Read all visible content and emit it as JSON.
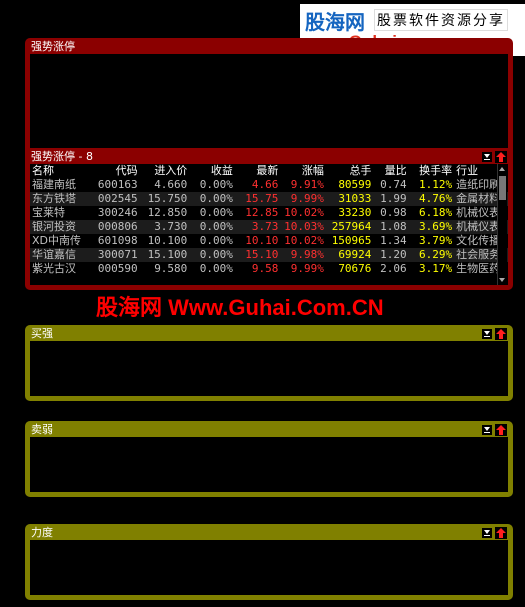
{
  "logo": {
    "brand": "股海网",
    "tagline": "股票软件资源分享",
    "url": "www.Guhai.com.cn"
  },
  "watermark": "股海网 Www.Guhai.Com.CN",
  "panels": {
    "top": {
      "title": "强势涨停"
    },
    "main": {
      "title": "强势涨停 - 8",
      "columns": [
        "名称",
        "代码",
        "进入价",
        "收益",
        "最新",
        "涨幅",
        "总手",
        "量比",
        "换手率",
        "行业"
      ],
      "rows": [
        {
          "name": "福建南纸",
          "code": "600163",
          "entry": "4.660",
          "gain": "0.00%",
          "last": "4.66",
          "chg": "9.91%",
          "vol": "80599",
          "ratio": "0.74",
          "turn": "1.12%",
          "ind": "造纸印刷"
        },
        {
          "name": "东方铁塔",
          "code": "002545",
          "entry": "15.750",
          "gain": "0.00%",
          "last": "15.75",
          "chg": "9.99%",
          "vol": "31033",
          "ratio": "1.99",
          "turn": "4.76%",
          "ind": "金属材料"
        },
        {
          "name": "宝莱特",
          "code": "300246",
          "entry": "12.850",
          "gain": "0.00%",
          "last": "12.85",
          "chg": "10.02%",
          "vol": "33230",
          "ratio": "0.98",
          "turn": "6.18%",
          "ind": "机械仪表"
        },
        {
          "name": "银河投资",
          "code": "000806",
          "entry": "3.730",
          "gain": "0.00%",
          "last": "3.73",
          "chg": "10.03%",
          "vol": "257964",
          "ratio": "1.08",
          "turn": "3.69%",
          "ind": "机械仪表"
        },
        {
          "name": "XD中南传",
          "code": "601098",
          "entry": "10.100",
          "gain": "0.00%",
          "last": "10.10",
          "chg": "10.02%",
          "vol": "150965",
          "ratio": "1.34",
          "turn": "3.79%",
          "ind": "文化传播"
        },
        {
          "name": "华谊嘉信",
          "code": "300071",
          "entry": "15.100",
          "gain": "0.00%",
          "last": "15.10",
          "chg": "9.98%",
          "vol": "69924",
          "ratio": "1.20",
          "turn": "6.29%",
          "ind": "社会服务"
        },
        {
          "name": "紫光古汉",
          "code": "000590",
          "entry": "9.580",
          "gain": "0.00%",
          "last": "9.58",
          "chg": "9.99%",
          "vol": "70676",
          "ratio": "2.06",
          "turn": "3.17%",
          "ind": "生物医药"
        }
      ]
    },
    "buy": {
      "title": "买强"
    },
    "sell": {
      "title": "卖弱"
    },
    "force": {
      "title": "力度"
    }
  },
  "colors": {
    "red_frame": "#8b0000",
    "olive_frame": "#808000",
    "up": "#ff3030",
    "turnover": "#ffff00"
  },
  "icons": {
    "menu": "dropdown-menu-icon",
    "up": "red-up-arrow-icon"
  }
}
